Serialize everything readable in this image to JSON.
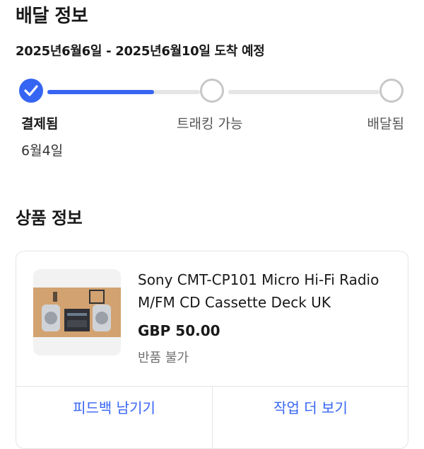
{
  "delivery": {
    "title": "배달 정보",
    "eta": "2025년6월6일 - 2025년6월10일 도착 예정",
    "progress_fraction": 0.35,
    "steps": [
      {
        "label": "결제됨",
        "date": "6월4일",
        "status": "done"
      },
      {
        "label": "트래킹 가능",
        "status": "pending"
      },
      {
        "label": "배달됨",
        "status": "pending"
      }
    ]
  },
  "item": {
    "section_title": "상품 정보",
    "name": "Sony CMT-CP101 Micro Hi-Fi Radio M/FM CD Cassette Deck UK",
    "price": "GBP 50.00",
    "return_policy": "반품 불가",
    "actions": {
      "feedback": "피드백 남기기",
      "more": "작업 더 보기"
    }
  },
  "colors": {
    "accent": "#3665f3",
    "track": "#e5e5e5",
    "muted": "#707070"
  }
}
